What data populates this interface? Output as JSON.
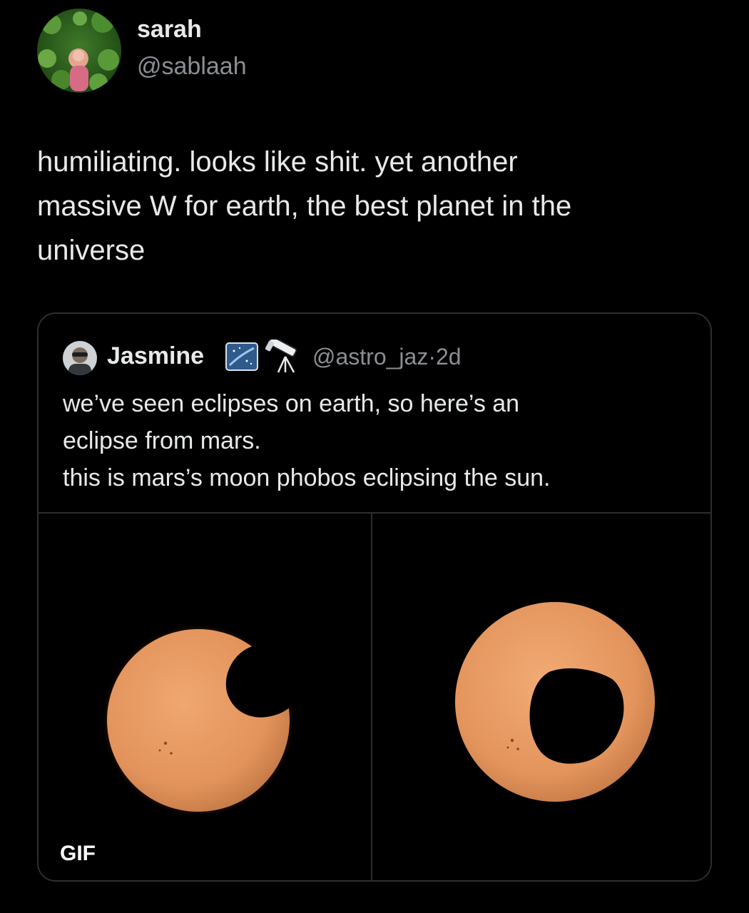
{
  "tweet": {
    "author": {
      "display_name": "sarah",
      "handle": "@sablaah"
    },
    "text": "humiliating. looks like shit. yet another\nmassive W for earth, the best planet in the\nuniverse"
  },
  "quote": {
    "author": {
      "display_name": "Jasmine",
      "handle": "@astro_jaz",
      "separator": "·",
      "timestamp": "2d",
      "emoji_icons": [
        "night-sky-emoji-icon",
        "telescope-emoji-icon"
      ]
    },
    "lines": [
      "we’ve seen eclipses on earth, so here’s an",
      "eclipse from mars.",
      "this is mars’s moon phobos eclipsing the sun."
    ],
    "media": {
      "gif_label": "GIF",
      "images": [
        {
          "name": "partial-eclipse-image"
        },
        {
          "name": "annular-eclipse-image"
        }
      ]
    }
  },
  "colors": {
    "background": "#000000",
    "text_primary": "#e7e9ea",
    "text_secondary": "#8b8f94",
    "border": "#2b2e31",
    "sun": "#e79a5f"
  }
}
